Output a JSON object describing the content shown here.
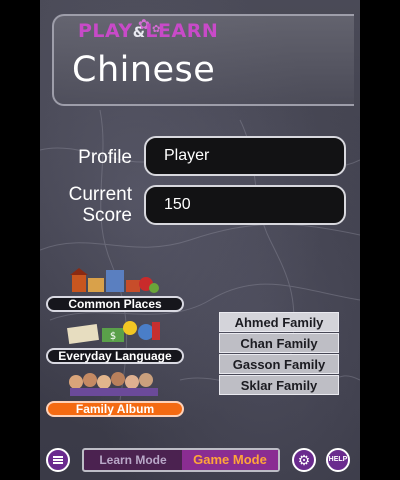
{
  "logo": {
    "play": "PLAY",
    "amp": "&",
    "learn": "LEARN",
    "title": "Chinese"
  },
  "profile": {
    "label": "Profile",
    "value": "Player"
  },
  "score": {
    "label_line1": "Current",
    "label_line2": "Score",
    "value": "150"
  },
  "categories": [
    {
      "label": "Common Places",
      "active": false
    },
    {
      "label": "Everyday Language",
      "active": false
    },
    {
      "label": "Family Album",
      "active": true
    }
  ],
  "families": [
    "Ahmed Family",
    "Chan Family",
    "Gasson Family",
    "Sklar Family"
  ],
  "modes": {
    "learn": "Learn Mode",
    "game": "Game Mode",
    "selected": "Game Mode"
  },
  "buttons": {
    "help": "HELP"
  },
  "colors": {
    "accent_orange": "#f46a12",
    "purple": "#8a2d92",
    "logo_pink": "#c84ac8"
  }
}
